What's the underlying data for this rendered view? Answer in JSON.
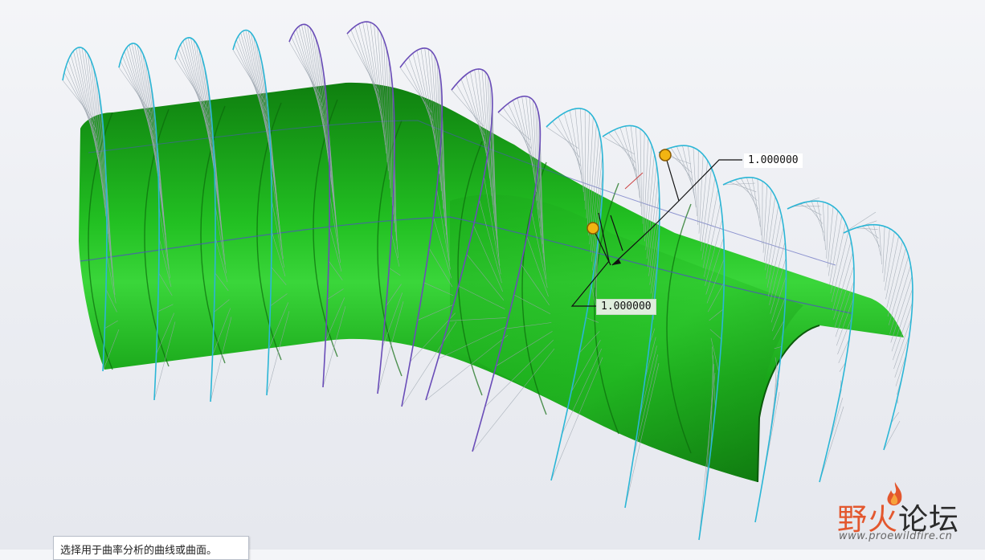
{
  "viewport": {
    "model_color": "#1fb21f",
    "curve_color": "#2bb6d6",
    "secondary_curve_color": "#6a4db8",
    "dimensions": [
      {
        "value": "1.000000"
      },
      {
        "value": "1.000000"
      }
    ]
  },
  "status": {
    "prompt": "选择用于曲率分析的曲线或曲面。"
  },
  "watermark": {
    "brand_part1": "野火",
    "brand_part2": "论坛",
    "url": "www.proewildfire.cn",
    "accent": "#e3572e"
  }
}
